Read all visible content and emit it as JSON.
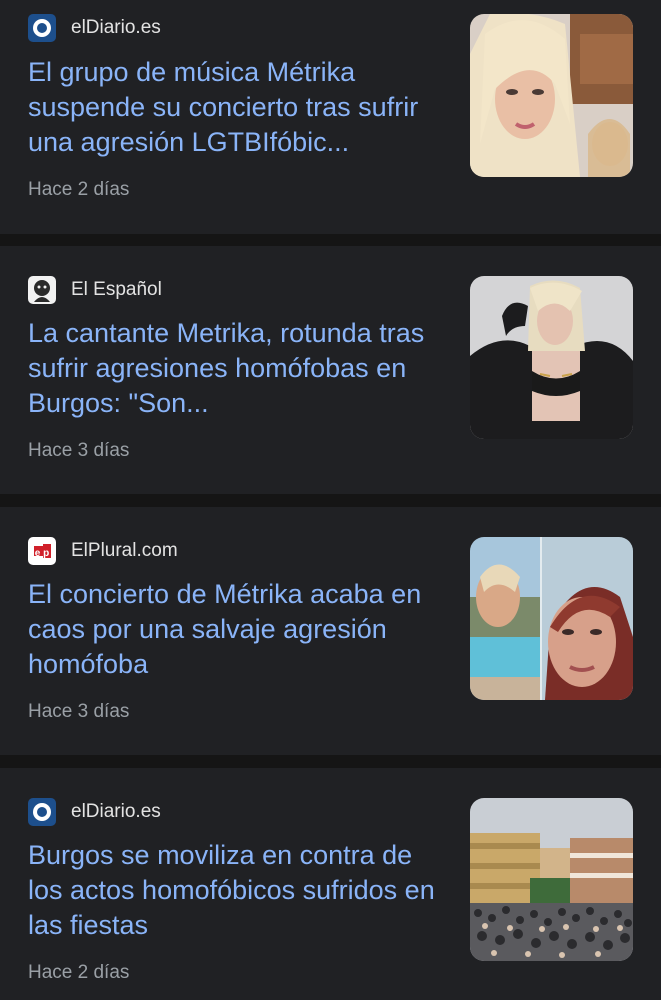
{
  "articles": [
    {
      "source": "elDiario.es",
      "source_icon": "eldiario-logo-icon",
      "headline": "El grupo de música Métrika suspende su concierto tras sufrir una agresión LGTBIfóbic...",
      "time": "Hace 2 días",
      "thumbnail": "blonde-singer-selfie"
    },
    {
      "source": "El Español",
      "source_icon": "elespanol-logo-icon",
      "headline": "La cantante Metrika, rotunda tras sufrir agresiones homófobas en Burgos: \"Son...",
      "time": "Hace 3 días",
      "thumbnail": "singer-portrait-black-outfit"
    },
    {
      "source": "ElPlural.com",
      "source_icon": "elplural-logo-icon",
      "headline": "El concierto de Métrika acaba en caos por una salvaje agresión homófoba",
      "time": "Hace 3 días",
      "thumbnail": "split-selfie-collage"
    },
    {
      "source": "elDiario.es",
      "source_icon": "eldiario-logo-icon",
      "headline": "Burgos se moviliza en contra de los actos homofóbicos sufridos en las fiestas",
      "time": "Hace 2 días",
      "thumbnail": "crowd-in-city-square"
    }
  ],
  "colors": {
    "background": "#151515",
    "card": "#202124",
    "headline": "#8ab4f8",
    "source_text": "#e3e3e3",
    "time_text": "#9aa0a6"
  }
}
